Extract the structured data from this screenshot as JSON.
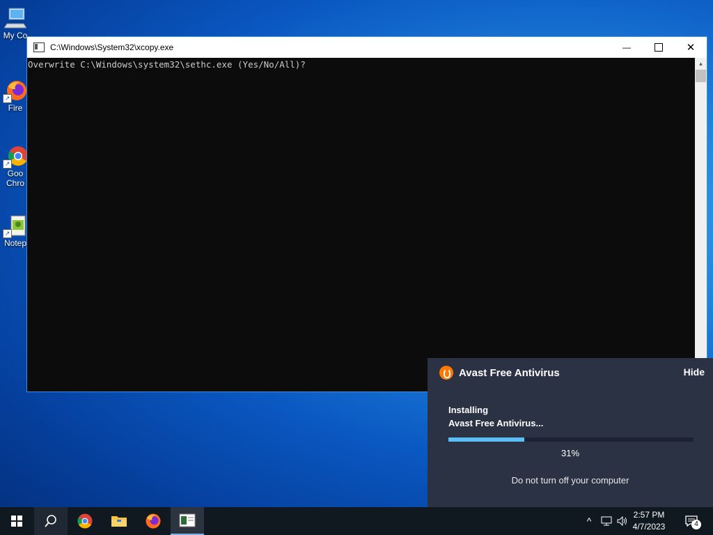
{
  "desktop": {
    "icons": [
      {
        "label": "My Co"
      },
      {
        "label": "Fire"
      },
      {
        "label": "Goo"
      },
      {
        "label": "Chro"
      },
      {
        "label": "Notep"
      }
    ]
  },
  "console": {
    "title": "C:\\Windows\\System32\\xcopy.exe",
    "output": "Overwrite C:\\Windows\\system32\\sethc.exe (Yes/No/All)?",
    "minimize_glyph": "—",
    "close_glyph": "✕"
  },
  "avast": {
    "title": "Avast Free Antivirus",
    "hide_label": "Hide",
    "status_line1": "Installing",
    "status_line2": "Avast Free Antivirus...",
    "progress_percent": 31,
    "progress_label": "31%",
    "note": "Do not turn off your computer",
    "accent": "#ff7800",
    "bar_color": "#5dbdf5"
  },
  "taskbar": {
    "clock_time": "2:57 PM",
    "clock_date": "4/7/2023",
    "notification_count": "4",
    "tray_chevron": "^"
  }
}
